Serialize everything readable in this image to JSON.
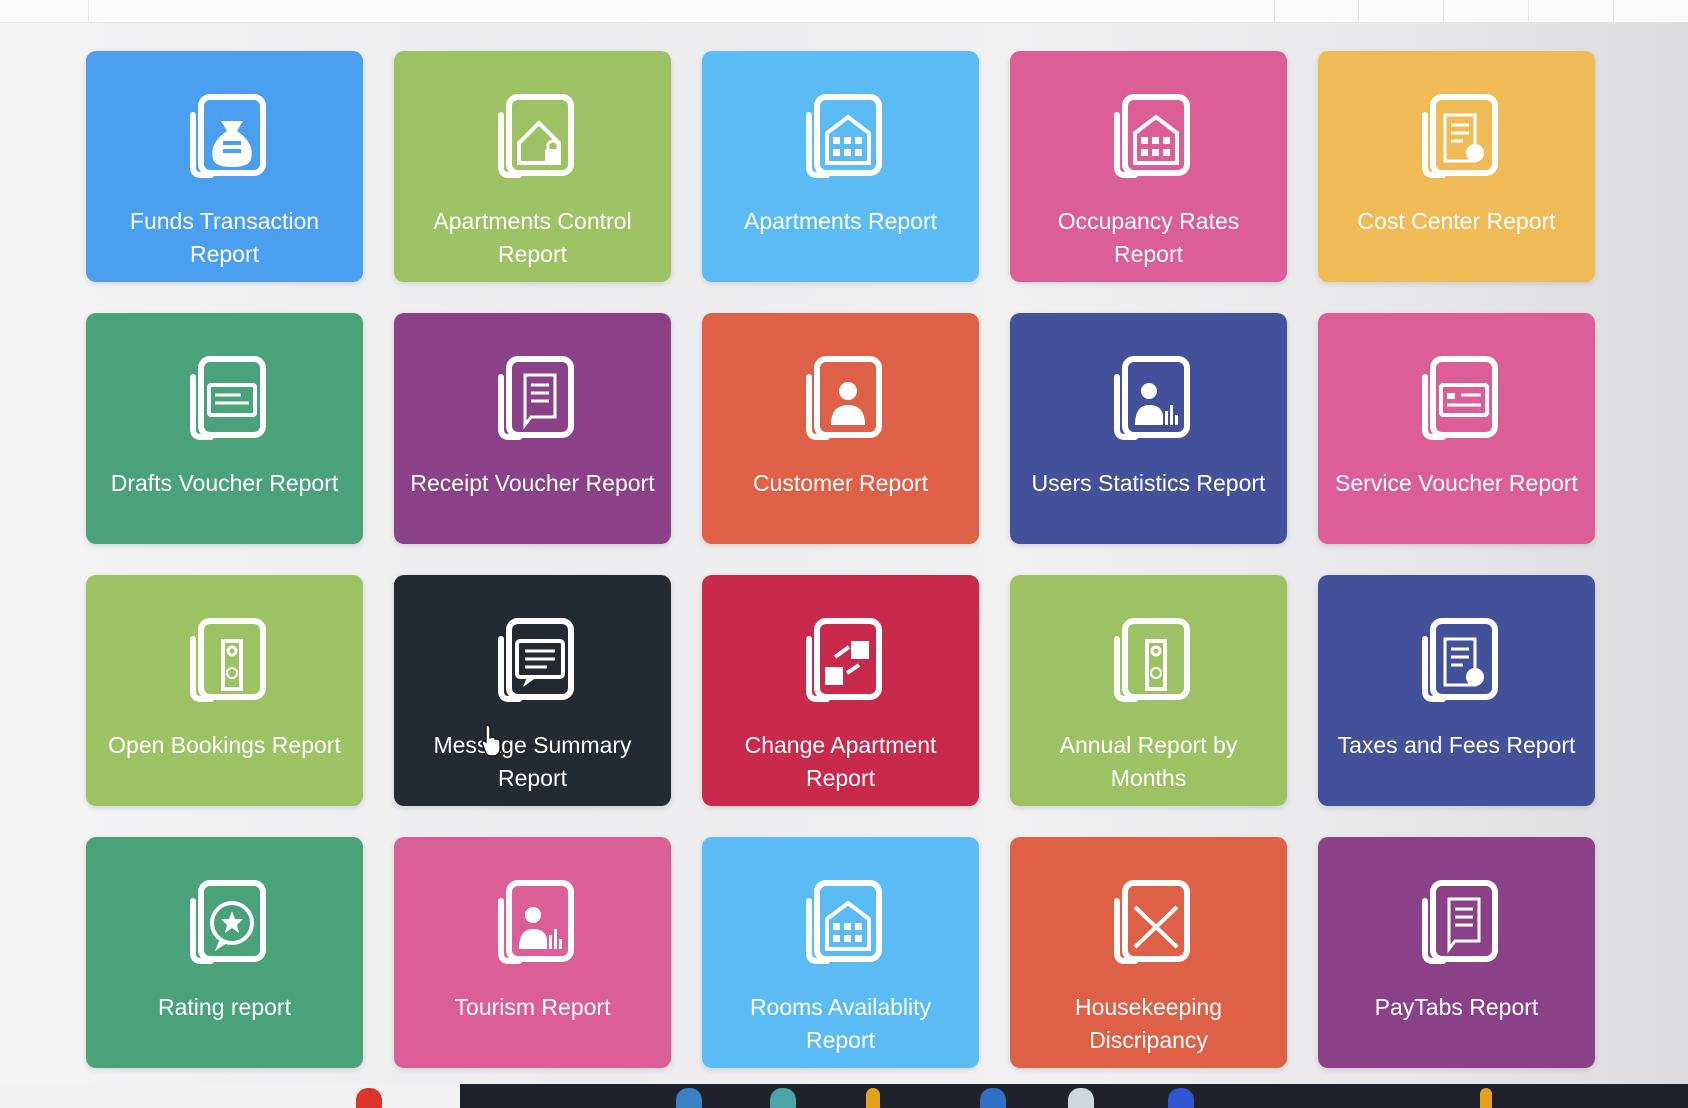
{
  "tiles": [
    {
      "label": "Funds Transaction Report",
      "color": "#4a9ff0",
      "icon": "money-bag-icon"
    },
    {
      "label": "Apartments Control Report",
      "color": "#9cc263",
      "icon": "locked-house-icon"
    },
    {
      "label": "Apartments Report",
      "color": "#5bbcf5",
      "icon": "building-icon"
    },
    {
      "label": "Occupancy Rates Report",
      "color": "#dc5e97",
      "icon": "building-icon"
    },
    {
      "label": "Cost Center Report",
      "color": "#f0bb56",
      "icon": "document-stack-icon"
    },
    {
      "label": "Drafts Voucher Report",
      "color": "#4aa27a",
      "icon": "voucher-card-icon"
    },
    {
      "label": "Receipt Voucher Report",
      "color": "#8a4188",
      "icon": "receipt-icon"
    },
    {
      "label": "Customer Report",
      "color": "#de6046",
      "icon": "person-icon"
    },
    {
      "label": "Users Statistics Report",
      "color": "#43519a",
      "icon": "user-stats-icon"
    },
    {
      "label": "Service Voucher Report",
      "color": "#dc5e97",
      "icon": "id-card-icon"
    },
    {
      "label": "Open Bookings Report",
      "color": "#9cc263",
      "icon": "door-hanger-icon"
    },
    {
      "label": "Message Summary Report",
      "color": "#232a31",
      "icon": "message-icon"
    },
    {
      "label": "Change Apartment Report",
      "color": "#c92a4c",
      "icon": "swap-buildings-icon"
    },
    {
      "label": "Annual Report by Months",
      "color": "#9cc263",
      "icon": "door-hanger-icon"
    },
    {
      "label": "Taxes and Fees Report",
      "color": "#43519a",
      "icon": "document-stack-icon"
    },
    {
      "label": "Rating report",
      "color": "#4aa27a",
      "icon": "star-chat-icon"
    },
    {
      "label": "Tourism Report",
      "color": "#dc5e97",
      "icon": "user-stats-icon"
    },
    {
      "label": "Rooms Availablity Report",
      "color": "#5bbcf5",
      "icon": "building-icon"
    },
    {
      "label": "Housekeeping Discripancy",
      "color": "#de6046",
      "icon": "discrepancy-icon"
    },
    {
      "label": "PayTabs Report",
      "color": "#8a4188",
      "icon": "receipt-icon"
    }
  ]
}
